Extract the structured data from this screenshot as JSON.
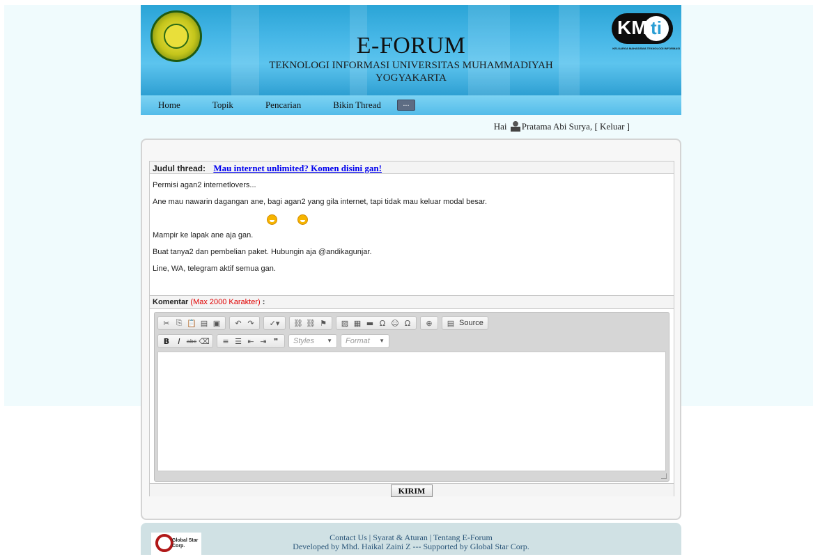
{
  "header": {
    "title": "E-FORUM",
    "subtitle": "TEKNOLOGI INFORMASI UNIVERSITAS MUHAMMADIYAH YOGYAKARTA",
    "kmti_logo_text": "KM",
    "kmti_logo_ti": "ti",
    "kmti_tagline": "KELUARGA MAHASISWA TEKNOLOGI INFORMASI"
  },
  "nav": {
    "items": [
      "Home",
      "Topik",
      "Pencarian",
      "Bikin Thread"
    ],
    "more_label": "..."
  },
  "user": {
    "greeting": "Hai",
    "name": "Pratama Abi Surya,",
    "logout": "[ Keluar ]"
  },
  "thread": {
    "title_label": "Judul thread:",
    "title": "Mau internet unlimited? Komen disini gan!",
    "paragraphs": [
      "Permisi agan2 internetlovers...",
      "Ane mau nawarin dagangan ane, bagi agan2 yang gila internet, tapi tidak mau keluar modal besar.",
      "Mampir ke lapak ane aja gan.",
      "Buat tanya2 dan pembelian paket. Hubungin aja @andikagunjar.",
      "Line, WA, telegram aktif semua gan."
    ]
  },
  "comment": {
    "label": "Komentar",
    "limit": "(Max 2000 Karakter)",
    "colon": ":",
    "styles_placeholder": "Styles",
    "format_placeholder": "Format",
    "source_label": "Source",
    "submit_label": "KIRIM"
  },
  "footer": {
    "logo_text": "Global Star Corp.",
    "links": [
      "Contact Us",
      "Syarat & Aturan",
      "Tentang E-Forum"
    ],
    "credit": "Developed by Mhd. Haikal Zaini Z --- Supported by Global Star Corp."
  },
  "colors": {
    "header_blue": "#45b6e6",
    "nav_blue": "#7dd3f3",
    "link": "#0000ee",
    "limit_red": "#e00000",
    "footer_bg": "#d0e1e4"
  }
}
